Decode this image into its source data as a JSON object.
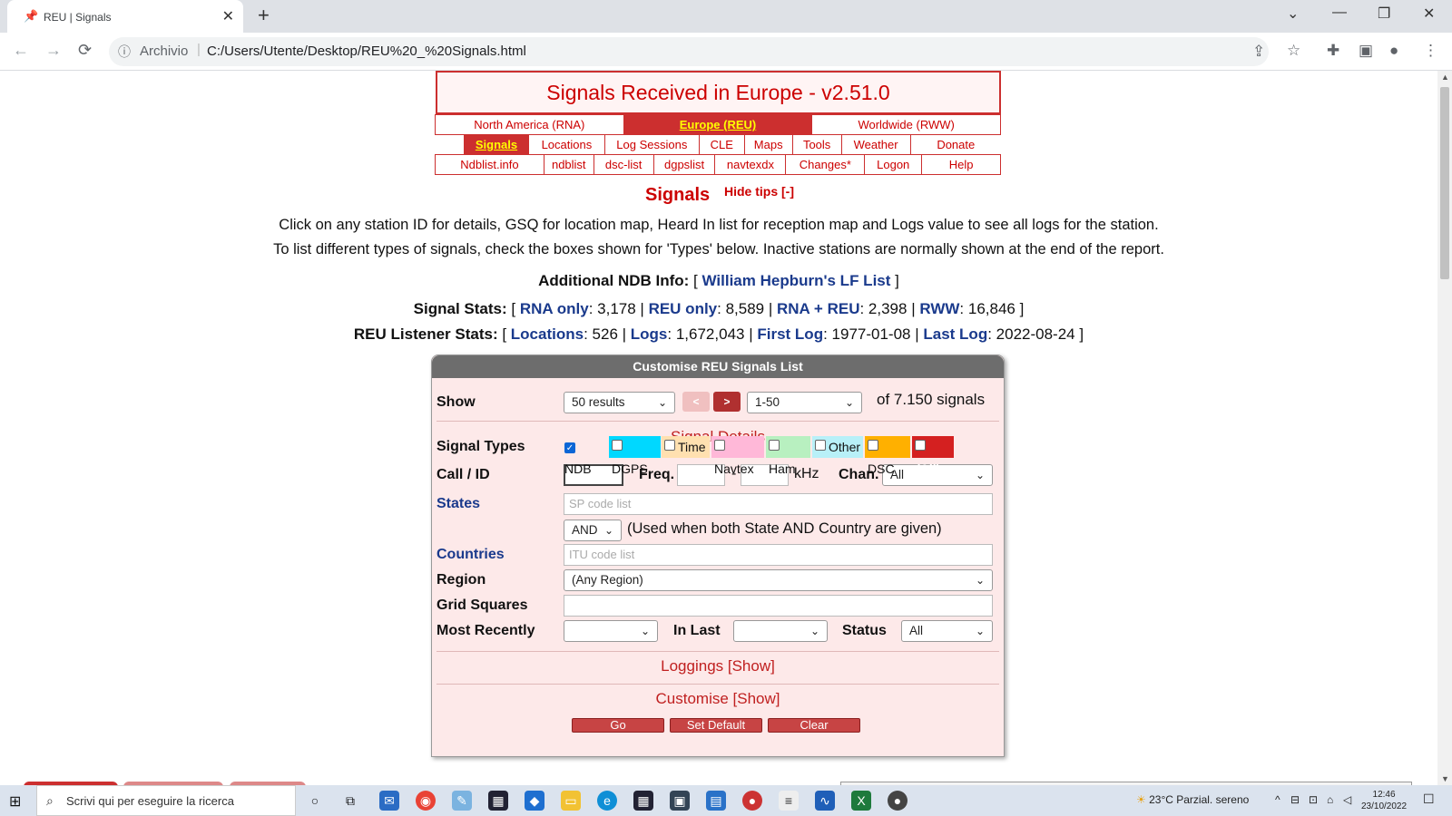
{
  "browser": {
    "tab_title": "REU | Signals",
    "omnibox_label": "Archivio",
    "url": "C:/Users/Utente/Desktop/REU%20_%20Signals.html"
  },
  "page": {
    "title": "Signals Received in Europe - v2.51.0",
    "nav_regions": [
      "North America (RNA)",
      "Europe (REU)",
      "Worldwide (RWW)"
    ],
    "nav_row2": [
      "Signals",
      "Locations",
      "Log Sessions",
      "CLE",
      "Maps",
      "Tools",
      "Weather",
      "Donate"
    ],
    "nav_row3": [
      "Ndblist.info",
      "ndblist",
      "dsc-list",
      "dgpslist",
      "navtexdx",
      "Changes*",
      "Logon",
      "Help"
    ],
    "heading": "Signals",
    "hide_tips": "Hide tips [-]",
    "tip1": "Click on any station ID for details, GSQ for location map, Heard In list for reception map and Logs value to see all logs for the station.",
    "tip2": "To list different types of signals, check the boxes shown for 'Types' below. Inactive stations are normally shown at the end of the report.",
    "ndb_info_label": "Additional NDB Info:",
    "ndb_info_link": "William Hepburn's LF List",
    "signal_stats": {
      "label": "Signal Stats:",
      "rna_label": "RNA only",
      "rna_value": "3,178",
      "reu_label": "REU only",
      "reu_value": "8,589",
      "both_label": "RNA + REU",
      "both_value": "2,398",
      "rww_label": "RWW",
      "rww_value": "16,846"
    },
    "listener_stats": {
      "label": "REU Listener Stats:",
      "locations_label": "Locations",
      "locations_value": "526",
      "logs_label": "Logs",
      "logs_value": "1,672,043",
      "first_label": "First Log",
      "first_value": "1977-01-08",
      "last_label": "Last Log",
      "last_value": "2022-08-24"
    }
  },
  "form": {
    "header": "Customise REU Signals List",
    "show_label": "Show",
    "show_value": "50 results",
    "prev_label": "<",
    "next_label": ">",
    "range_value": "1-50",
    "total_text": "of 7.150 signals",
    "details_title": "Signal Details",
    "types_label": "Signal Types",
    "types": [
      {
        "label": "NDB",
        "checked": true,
        "color": "#fde9e9"
      },
      {
        "label": "DGPS",
        "checked": false,
        "color": "#00d8ff"
      },
      {
        "label": "Time",
        "checked": false,
        "color": "#ffe0b0"
      },
      {
        "label": "Navtex",
        "checked": false,
        "color": "#ffb8d8"
      },
      {
        "label": "Ham",
        "checked": false,
        "color": "#b8f0c0"
      },
      {
        "label": "Other",
        "checked": false,
        "color": "#b8f0f8"
      },
      {
        "label": "DSC",
        "checked": false,
        "color": "#ffb000"
      },
      {
        "label": "(All)",
        "checked": false,
        "color": "#d42020"
      }
    ],
    "call_label": "Call / ID",
    "freq_label": "Freq.",
    "freq_sep": "-",
    "khz_label": "kHz",
    "chan_label": "Chan.",
    "chan_value": "All",
    "states_label": "States",
    "states_placeholder": "SP code list",
    "and_value": "AND",
    "and_note": "(Used when both State AND Country are given)",
    "countries_label": "Countries",
    "countries_placeholder": "ITU code list",
    "region_label": "Region",
    "region_value": "(Any Region)",
    "grid_label": "Grid Squares",
    "recent_label": "Most Recently",
    "inlast_label": "In Last",
    "status_label": "Status",
    "status_value": "All",
    "loggings": "Loggings [Show]",
    "customise": "Customise [Show]",
    "go": "Go",
    "set_default": "Set Default",
    "clear": "Clear"
  },
  "taskbar": {
    "search_text": "Scrivi qui per eseguire la ricerca",
    "weather": "23°C  Parzial. sereno",
    "time": "12:46",
    "date": "23/10/2022"
  }
}
